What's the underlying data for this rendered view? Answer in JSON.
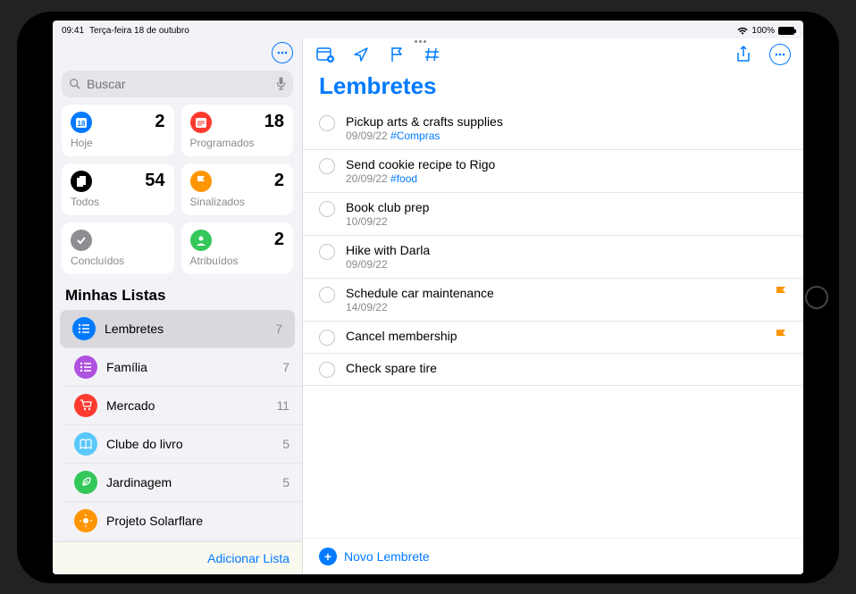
{
  "statusbar": {
    "time": "09:41",
    "date": "Terça-feira 18 de outubro",
    "battery_pct": "100%"
  },
  "search": {
    "placeholder": "Buscar"
  },
  "smart": [
    {
      "label": "Hoje",
      "count": "2",
      "iconClass": "ic-today"
    },
    {
      "label": "Programados",
      "count": "18",
      "iconClass": "ic-scheduled"
    },
    {
      "label": "Todos",
      "count": "54",
      "iconClass": "ic-all"
    },
    {
      "label": "Sinalizados",
      "count": "2",
      "iconClass": "ic-flagged"
    },
    {
      "label": "Concluídos",
      "count": "",
      "iconClass": "ic-completed"
    },
    {
      "label": "Atribuídos",
      "count": "2",
      "iconClass": "ic-assigned"
    }
  ],
  "lists_header": "Minhas Listas",
  "lists": [
    {
      "name": "Lembretes",
      "count": "7",
      "color": "lc-blue",
      "selected": true,
      "icon": "list"
    },
    {
      "name": "Família",
      "count": "7",
      "color": "lc-purple",
      "selected": false,
      "icon": "list"
    },
    {
      "name": "Mercado",
      "count": "11",
      "color": "lc-red",
      "selected": false,
      "icon": "cart"
    },
    {
      "name": "Clube do livro",
      "count": "5",
      "color": "lc-lightblue",
      "selected": false,
      "icon": "book"
    },
    {
      "name": "Jardinagem",
      "count": "5",
      "color": "lc-green",
      "selected": false,
      "icon": "leaf"
    },
    {
      "name": "Projeto Solarflare",
      "count": "",
      "color": "lc-orange",
      "selected": false,
      "icon": "sun"
    }
  ],
  "add_list_label": "Adicionar Lista",
  "content_title": "Lembretes",
  "reminders": [
    {
      "title": "Pickup arts & crafts supplies",
      "date": "09/09/22",
      "tag": "#Compras",
      "flagged": false
    },
    {
      "title": "Send cookie recipe to Rigo",
      "date": "20/09/22",
      "tag": "#food",
      "flagged": false
    },
    {
      "title": "Book club prep",
      "date": "10/09/22",
      "tag": "",
      "flagged": false
    },
    {
      "title": "Hike with Darla",
      "date": "09/09/22",
      "tag": "",
      "flagged": false
    },
    {
      "title": "Schedule car maintenance",
      "date": "14/09/22",
      "tag": "",
      "flagged": true
    },
    {
      "title": "Cancel membership",
      "date": "",
      "tag": "",
      "flagged": true
    },
    {
      "title": "Check spare tire",
      "date": "",
      "tag": "",
      "flagged": false
    }
  ],
  "new_reminder_label": "Novo Lembrete"
}
